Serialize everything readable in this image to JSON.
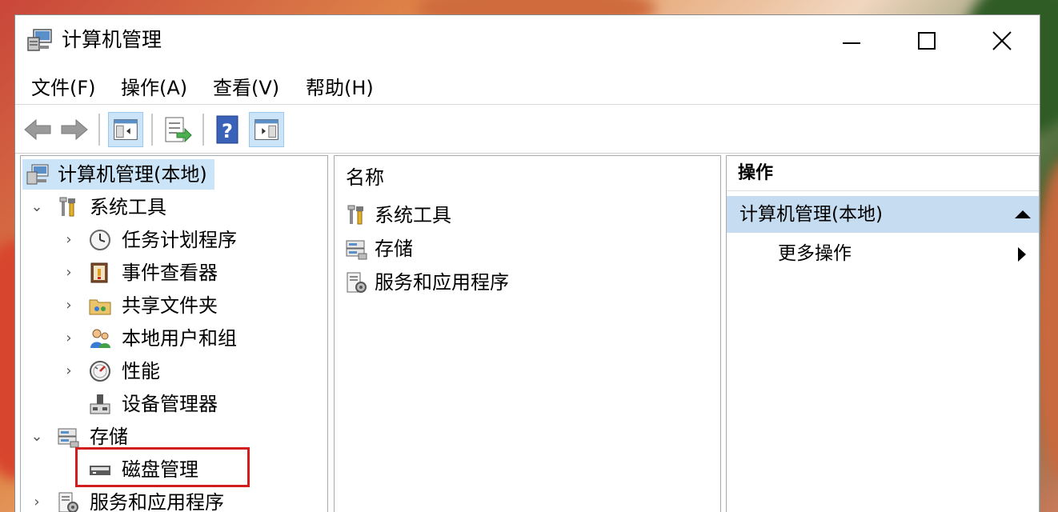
{
  "window": {
    "title": "计算机管理",
    "icon": "computer-management-icon"
  },
  "caption_buttons": {
    "minimize": "minimize-icon",
    "maximize": "maximize-icon",
    "close": "close-icon"
  },
  "menu": {
    "items": [
      {
        "label": "文件(F)"
      },
      {
        "label": "操作(A)"
      },
      {
        "label": "查看(V)"
      },
      {
        "label": "帮助(H)"
      }
    ]
  },
  "toolbar": {
    "buttons": [
      "back-arrow-icon",
      "forward-arrow-icon",
      "show-hide-console-tree-icon",
      "export-list-icon",
      "help-icon",
      "show-hide-action-pane-icon"
    ]
  },
  "tree": {
    "root": "计算机管理(本地)",
    "system_tools": "系统工具",
    "task_scheduler": "任务计划程序",
    "event_viewer": "事件查看器",
    "shared_folders": "共享文件夹",
    "local_users_groups": "本地用户和组",
    "performance": "性能",
    "device_manager": "设备管理器",
    "storage": "存储",
    "disk_management": "磁盘管理",
    "services_apps": "服务和应用程序"
  },
  "middle": {
    "column_header": "名称",
    "items": [
      {
        "label": "系统工具"
      },
      {
        "label": "存储"
      },
      {
        "label": "服务和应用程序"
      }
    ]
  },
  "actions": {
    "title": "操作",
    "section": "计算机管理(本地)",
    "more": "更多操作"
  },
  "colors": {
    "selection": "#cce4f7",
    "action_section": "#c6dcf1",
    "highlight_box": "#d11f1f"
  }
}
